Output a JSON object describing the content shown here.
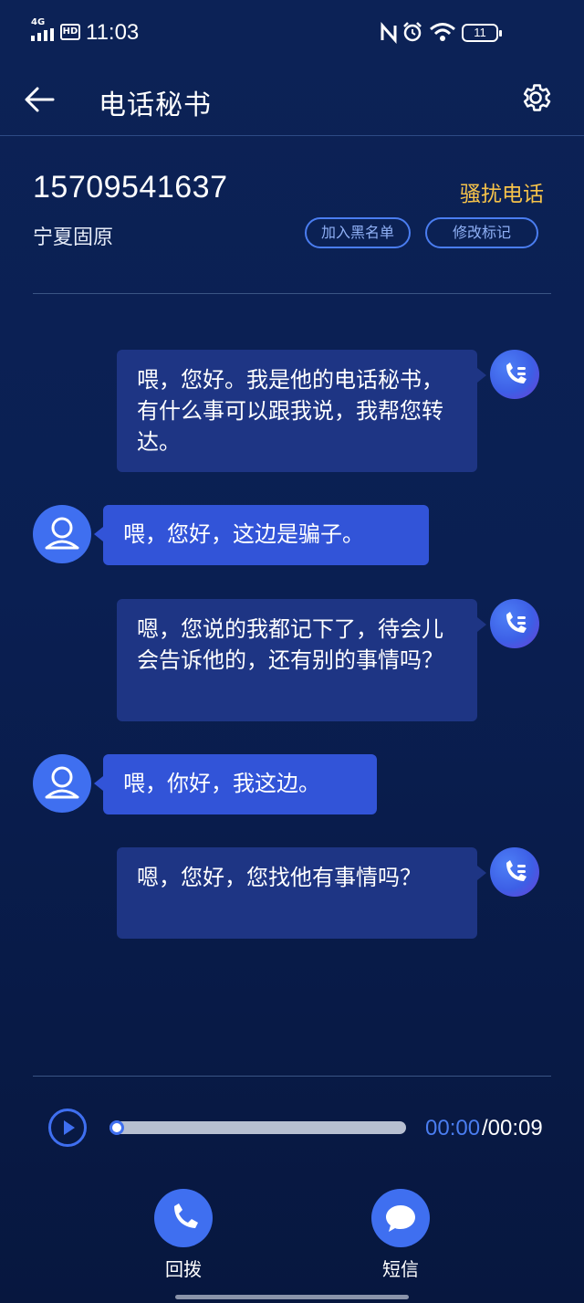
{
  "status_bar": {
    "network": "4G",
    "hd": "HD",
    "time": "11:03",
    "battery": "11"
  },
  "header": {
    "title": "电话秘书"
  },
  "caller": {
    "number": "15709541637",
    "location": "宁夏固原",
    "tag": "骚扰电话",
    "blacklist_label": "加入黑名单",
    "edit_mark_label": "修改标记"
  },
  "messages": [
    {
      "speaker": "secretary",
      "text": "喂，您好。我是他的电话秘书，有什么事可以跟我说，我帮您转达。"
    },
    {
      "speaker": "caller",
      "text": "喂，您好，这边是骗子。"
    },
    {
      "speaker": "secretary",
      "text": "嗯，您说的我都记下了，待会儿会告诉他的，还有别的事情吗？"
    },
    {
      "speaker": "caller",
      "text": "喂，你好，我这边。"
    },
    {
      "speaker": "secretary",
      "text": "嗯，您好，您找他有事情吗？"
    }
  ],
  "player": {
    "current": "00:00",
    "total": "/00:09",
    "progress": 0
  },
  "actions": {
    "call_back": "回拨",
    "sms": "短信"
  },
  "colors": {
    "accent": "#3f6ff0",
    "tag": "#f6c34a",
    "secretary_bubble": "#1e3584",
    "caller_bubble": "#3254d8"
  }
}
